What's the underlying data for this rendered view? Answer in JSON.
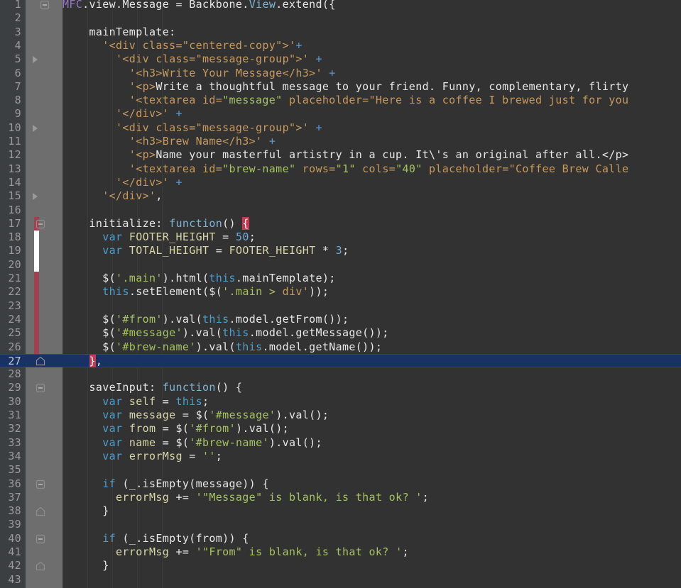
{
  "editor": {
    "name": "code-editor",
    "language": "JavaScript",
    "total_lines": 43,
    "current_line": 27,
    "colors": {
      "background": "#323232",
      "gutter_numbers_bg": "#3c3f41",
      "gutter_folds_bg": "#6e6e6e",
      "line_number": "#9a9a9a",
      "current_line_highlight": "#1a3163",
      "change_bar_modified": "#9e4252",
      "change_bar_added": "#ffffff",
      "brace_match_highlight": "#c23b50",
      "string_html": "#c8995e",
      "string_js": "#a5c261",
      "keyword": "#4d9fd0",
      "class_name": "#9876c8",
      "type_name": "#7fb4d4",
      "identifier": "#d6d6a8",
      "number": "#6fa8dc",
      "plus_operator": "#5c9ad6",
      "default_text": "#e8e8e8"
    },
    "change_bar": {
      "modified_from_line": 17,
      "modified_to_line": 27,
      "added_from_line": 18,
      "added_to_line": 20
    },
    "fold_markers": [
      {
        "line": 1,
        "type": "fold-expanded-icon"
      },
      {
        "line": 5,
        "type": "fold-collapsed-icon"
      },
      {
        "line": 10,
        "type": "fold-collapsed-icon"
      },
      {
        "line": 15,
        "type": "fold-collapsed-icon"
      },
      {
        "line": 17,
        "type": "fold-expanded-icon"
      },
      {
        "line": 27,
        "type": "fold-end-icon"
      },
      {
        "line": 29,
        "type": "fold-expanded-icon"
      },
      {
        "line": 36,
        "type": "fold-expanded-icon"
      },
      {
        "line": 38,
        "type": "fold-end-icon"
      },
      {
        "line": 40,
        "type": "fold-expanded-icon"
      },
      {
        "line": 42,
        "type": "fold-end-icon"
      }
    ],
    "lines": [
      {
        "n": 1,
        "tokens": [
          {
            "t": "MFC",
            "c": "t-class"
          },
          {
            "t": ".view.Message ",
            "c": "t-plain"
          },
          {
            "t": "= ",
            "c": "t-op"
          },
          {
            "t": "Backbone.",
            "c": "t-plain"
          },
          {
            "t": "View",
            "c": "t-type"
          },
          {
            "t": ".extend({",
            "c": "t-plain"
          }
        ]
      },
      {
        "n": 2,
        "tokens": []
      },
      {
        "n": 3,
        "tokens": [
          {
            "t": "    mainTemplate:",
            "c": "t-plain"
          }
        ]
      },
      {
        "n": 4,
        "tokens": [
          {
            "t": "      '<div class=\"centered-copy\">'",
            "c": "t-str"
          },
          {
            "t": "+",
            "c": "t-plus"
          }
        ]
      },
      {
        "n": 5,
        "tokens": [
          {
            "t": "        '<div class=\"message-group\">' ",
            "c": "t-str"
          },
          {
            "t": "+",
            "c": "t-plus"
          }
        ]
      },
      {
        "n": 6,
        "tokens": [
          {
            "t": "          '<h3>Write Your Message</h3>' ",
            "c": "t-str"
          },
          {
            "t": "+",
            "c": "t-plus"
          }
        ]
      },
      {
        "n": 7,
        "tokens": [
          {
            "t": "          '<p>",
            "c": "t-str"
          },
          {
            "t": "Write a thoughtful message to your friend. Funny, complementary, flirty",
            "c": "t-plain"
          }
        ]
      },
      {
        "n": 8,
        "tokens": [
          {
            "t": "          '<textarea id=",
            "c": "t-str"
          },
          {
            "t": "\"message\"",
            "c": "t-jsstr"
          },
          {
            "t": " placeholder=",
            "c": "t-str"
          },
          {
            "t": "\"Here is a coffee I brewed just for you",
            "c": "t-str"
          }
        ]
      },
      {
        "n": 9,
        "tokens": [
          {
            "t": "        '</div>' ",
            "c": "t-str"
          },
          {
            "t": "+",
            "c": "t-plus"
          }
        ]
      },
      {
        "n": 10,
        "tokens": [
          {
            "t": "        '<div class=\"message-group\">' ",
            "c": "t-str"
          },
          {
            "t": "+",
            "c": "t-plus"
          }
        ]
      },
      {
        "n": 11,
        "tokens": [
          {
            "t": "          '<h3>Brew Name</h3>' ",
            "c": "t-str"
          },
          {
            "t": "+",
            "c": "t-plus"
          }
        ]
      },
      {
        "n": 12,
        "tokens": [
          {
            "t": "          '<p>",
            "c": "t-str"
          },
          {
            "t": "Name your masterful artistry in a cup. It\\'s an original after all.</p>",
            "c": "t-plain"
          }
        ]
      },
      {
        "n": 13,
        "tokens": [
          {
            "t": "          '<textarea id=",
            "c": "t-str"
          },
          {
            "t": "\"brew-name\"",
            "c": "t-jsstr"
          },
          {
            "t": " rows=",
            "c": "t-str"
          },
          {
            "t": "\"1\"",
            "c": "t-jsstr"
          },
          {
            "t": " cols=",
            "c": "t-str"
          },
          {
            "t": "\"40\"",
            "c": "t-jsstr"
          },
          {
            "t": " placeholder=",
            "c": "t-str"
          },
          {
            "t": "\"Coffee Brew Calle",
            "c": "t-str"
          }
        ]
      },
      {
        "n": 14,
        "tokens": [
          {
            "t": "        '</div>' ",
            "c": "t-str"
          },
          {
            "t": "+",
            "c": "t-plus"
          }
        ]
      },
      {
        "n": 15,
        "tokens": [
          {
            "t": "      '</div>'",
            "c": "t-str"
          },
          {
            "t": ",",
            "c": "t-plain"
          }
        ]
      },
      {
        "n": 16,
        "tokens": []
      },
      {
        "n": 17,
        "tokens": [
          {
            "t": "    initialize: ",
            "c": "t-plain"
          },
          {
            "t": "function",
            "c": "t-type"
          },
          {
            "t": "() ",
            "c": "t-plain"
          },
          {
            "t": "{",
            "c": "t-brace-hl"
          }
        ]
      },
      {
        "n": 18,
        "tokens": [
          {
            "t": "      ",
            "c": "t-plain"
          },
          {
            "t": "var",
            "c": "t-kw"
          },
          {
            "t": " FOOTER_HEIGHT ",
            "c": "t-field"
          },
          {
            "t": "= ",
            "c": "t-op"
          },
          {
            "t": "50",
            "c": "t-num"
          },
          {
            "t": ";",
            "c": "t-plain"
          }
        ]
      },
      {
        "n": 19,
        "tokens": [
          {
            "t": "      ",
            "c": "t-plain"
          },
          {
            "t": "var",
            "c": "t-kw"
          },
          {
            "t": " TOTAL_HEIGHT ",
            "c": "t-field"
          },
          {
            "t": "= ",
            "c": "t-op"
          },
          {
            "t": "FOOTER_HEIGHT ",
            "c": "t-field"
          },
          {
            "t": "* ",
            "c": "t-op"
          },
          {
            "t": "3",
            "c": "t-num"
          },
          {
            "t": ";",
            "c": "t-plain"
          }
        ]
      },
      {
        "n": 20,
        "tokens": []
      },
      {
        "n": 21,
        "tokens": [
          {
            "t": "      $(",
            "c": "t-plain"
          },
          {
            "t": "'.main'",
            "c": "t-jsstr"
          },
          {
            "t": ").html(",
            "c": "t-plain"
          },
          {
            "t": "this",
            "c": "t-kw"
          },
          {
            "t": ".mainTemplate);",
            "c": "t-plain"
          }
        ]
      },
      {
        "n": 22,
        "tokens": [
          {
            "t": "      ",
            "c": "t-plain"
          },
          {
            "t": "this",
            "c": "t-kw"
          },
          {
            "t": ".setElement($(",
            "c": "t-plain"
          },
          {
            "t": "'.main > ",
            "c": "t-jsstr"
          },
          {
            "t": "div'",
            "c": "t-str"
          },
          {
            "t": "));",
            "c": "t-plain"
          }
        ]
      },
      {
        "n": 23,
        "tokens": []
      },
      {
        "n": 24,
        "tokens": [
          {
            "t": "      $(",
            "c": "t-plain"
          },
          {
            "t": "'#from'",
            "c": "t-jsstr"
          },
          {
            "t": ").val(",
            "c": "t-plain"
          },
          {
            "t": "this",
            "c": "t-kw"
          },
          {
            "t": ".model.getFrom());",
            "c": "t-plain"
          }
        ]
      },
      {
        "n": 25,
        "tokens": [
          {
            "t": "      $(",
            "c": "t-plain"
          },
          {
            "t": "'#message'",
            "c": "t-jsstr"
          },
          {
            "t": ").val(",
            "c": "t-plain"
          },
          {
            "t": "this",
            "c": "t-kw"
          },
          {
            "t": ".model.getMessage());",
            "c": "t-plain"
          }
        ]
      },
      {
        "n": 26,
        "tokens": [
          {
            "t": "      $(",
            "c": "t-plain"
          },
          {
            "t": "'#brew-name'",
            "c": "t-jsstr"
          },
          {
            "t": ").val(",
            "c": "t-plain"
          },
          {
            "t": "this",
            "c": "t-kw"
          },
          {
            "t": ".model.getName());",
            "c": "t-plain"
          }
        ]
      },
      {
        "n": 27,
        "tokens": [
          {
            "t": "    ",
            "c": "t-plain"
          },
          {
            "t": "}",
            "c": "t-brace-hl"
          },
          {
            "t": ",",
            "c": "t-plain"
          }
        ]
      },
      {
        "n": 28,
        "tokens": []
      },
      {
        "n": 29,
        "tokens": [
          {
            "t": "    saveInput: ",
            "c": "t-plain"
          },
          {
            "t": "function",
            "c": "t-type"
          },
          {
            "t": "() {",
            "c": "t-plain"
          }
        ]
      },
      {
        "n": 30,
        "tokens": [
          {
            "t": "      ",
            "c": "t-plain"
          },
          {
            "t": "var",
            "c": "t-kw"
          },
          {
            "t": " self ",
            "c": "t-field"
          },
          {
            "t": "= ",
            "c": "t-op"
          },
          {
            "t": "this",
            "c": "t-kw"
          },
          {
            "t": ";",
            "c": "t-plain"
          }
        ]
      },
      {
        "n": 31,
        "tokens": [
          {
            "t": "      ",
            "c": "t-plain"
          },
          {
            "t": "var",
            "c": "t-kw"
          },
          {
            "t": " message ",
            "c": "t-field"
          },
          {
            "t": "= ",
            "c": "t-op"
          },
          {
            "t": "$(",
            "c": "t-plain"
          },
          {
            "t": "'#message'",
            "c": "t-jsstr"
          },
          {
            "t": ").val();",
            "c": "t-plain"
          }
        ]
      },
      {
        "n": 32,
        "tokens": [
          {
            "t": "      ",
            "c": "t-plain"
          },
          {
            "t": "var",
            "c": "t-kw"
          },
          {
            "t": " from ",
            "c": "t-field"
          },
          {
            "t": "= ",
            "c": "t-op"
          },
          {
            "t": "$(",
            "c": "t-plain"
          },
          {
            "t": "'#from'",
            "c": "t-jsstr"
          },
          {
            "t": ").val();",
            "c": "t-plain"
          }
        ]
      },
      {
        "n": 33,
        "tokens": [
          {
            "t": "      ",
            "c": "t-plain"
          },
          {
            "t": "var",
            "c": "t-kw"
          },
          {
            "t": " name ",
            "c": "t-field"
          },
          {
            "t": "= ",
            "c": "t-op"
          },
          {
            "t": "$(",
            "c": "t-plain"
          },
          {
            "t": "'#brew-name'",
            "c": "t-jsstr"
          },
          {
            "t": ").val();",
            "c": "t-plain"
          }
        ]
      },
      {
        "n": 34,
        "tokens": [
          {
            "t": "      ",
            "c": "t-plain"
          },
          {
            "t": "var",
            "c": "t-kw"
          },
          {
            "t": " errorMsg ",
            "c": "t-field"
          },
          {
            "t": "= ",
            "c": "t-op"
          },
          {
            "t": "''",
            "c": "t-jsstr"
          },
          {
            "t": ";",
            "c": "t-plain"
          }
        ]
      },
      {
        "n": 35,
        "tokens": []
      },
      {
        "n": 36,
        "tokens": [
          {
            "t": "      ",
            "c": "t-plain"
          },
          {
            "t": "if",
            "c": "t-kw"
          },
          {
            "t": " (_.isEmpty(message)) {",
            "c": "t-plain"
          }
        ]
      },
      {
        "n": 37,
        "tokens": [
          {
            "t": "        errorMsg ",
            "c": "t-field"
          },
          {
            "t": "+= ",
            "c": "t-op"
          },
          {
            "t": "'\"Message\" is blank, is that ok? '",
            "c": "t-jsstr"
          },
          {
            "t": ";",
            "c": "t-plain"
          }
        ]
      },
      {
        "n": 38,
        "tokens": [
          {
            "t": "      }",
            "c": "t-plain"
          }
        ]
      },
      {
        "n": 39,
        "tokens": []
      },
      {
        "n": 40,
        "tokens": [
          {
            "t": "      ",
            "c": "t-plain"
          },
          {
            "t": "if",
            "c": "t-kw"
          },
          {
            "t": " (_.isEmpty(from)) {",
            "c": "t-plain"
          }
        ]
      },
      {
        "n": 41,
        "tokens": [
          {
            "t": "        errorMsg ",
            "c": "t-field"
          },
          {
            "t": "+= ",
            "c": "t-op"
          },
          {
            "t": "'\"From\" is blank, is that ok? '",
            "c": "t-jsstr"
          },
          {
            "t": ";",
            "c": "t-plain"
          }
        ]
      },
      {
        "n": 42,
        "tokens": [
          {
            "t": "      }",
            "c": "t-plain"
          }
        ]
      },
      {
        "n": 43,
        "tokens": []
      }
    ]
  }
}
